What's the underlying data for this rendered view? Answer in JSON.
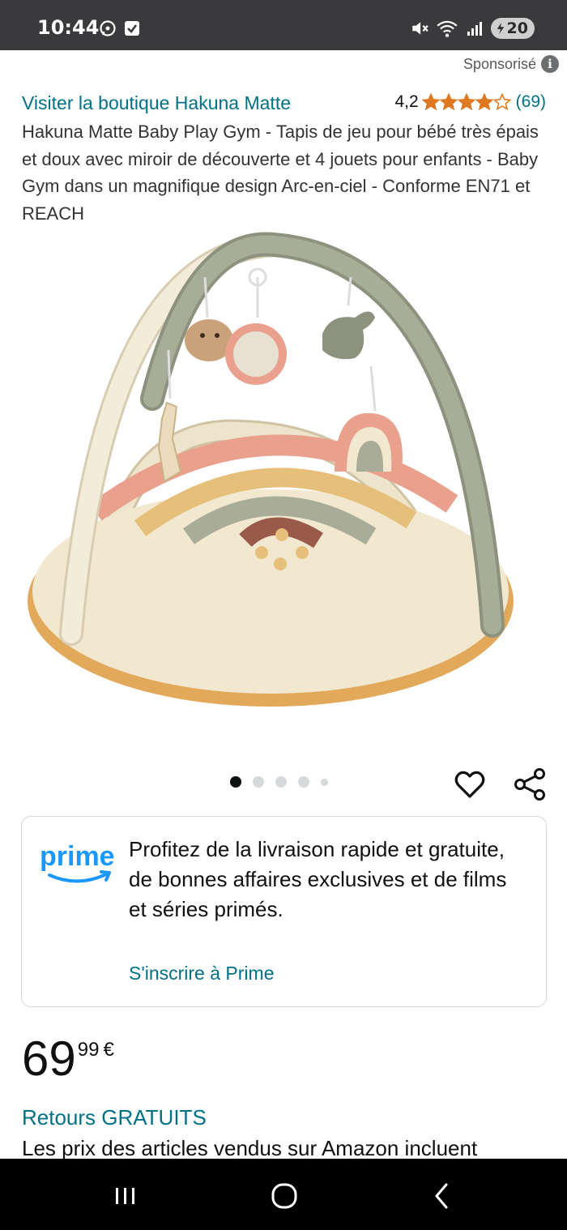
{
  "status_bar": {
    "time": "10:44",
    "battery": "20",
    "icons": [
      "whatsapp-icon",
      "checkbox-notification-icon",
      "mute-icon",
      "wifi-icon",
      "signal-icon",
      "battery-icon"
    ]
  },
  "sponsored_label": "Sponsorisé",
  "store_link": "Visiter la boutique Hakuna Matte",
  "rating": {
    "value": "4,2",
    "stars": 4.2,
    "count": "(69)"
  },
  "product_title": "Hakuna Matte Baby Play Gym - Tapis de jeu pour bébé très épais et doux avec miroir de découverte et 4 jouets pour enfants - Baby Gym dans un magnifique design Arc-en-ciel - Conforme EN71 et REACH",
  "carousel": {
    "total": 5,
    "active": 0
  },
  "prime": {
    "logo_text": "prime",
    "text": "Profitez de la livraison rapide et gratuite, de bonnes affaires exclusives et de films et séries primés.",
    "link": "S'inscrire à Prime"
  },
  "price": {
    "whole": "69",
    "fraction": "99",
    "currency": "€"
  },
  "returns": "Retours GRATUITS",
  "tax_note": "Les prix des articles vendus sur Amazon incluent",
  "colors": {
    "link": "#007185",
    "star": "#de7921",
    "prime_blue": "#1a98ff"
  }
}
